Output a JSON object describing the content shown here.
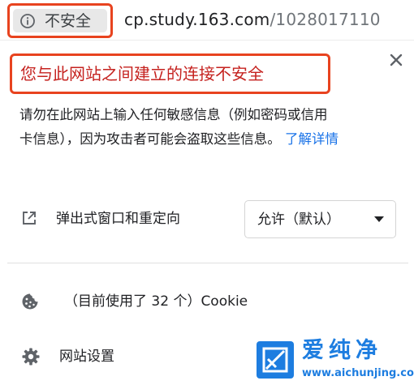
{
  "address_bar": {
    "security_label": "不安全",
    "url_host": "cp.study.163.com",
    "url_path": "/1028017110"
  },
  "popup": {
    "headline": "您与此网站之间建立的连接不安全",
    "description_line1": "请勿在此网站上输入任何敏感信息（例如密码或信用",
    "description_line2": "卡信息），因为攻击者可能会盗取这些信息。",
    "learn_more_link": "了解详情",
    "popup_permission": {
      "label": "弹出式窗口和重定向",
      "selected_option": "允许（默认）"
    },
    "cookies": {
      "label": "（目前使用了 32 个）Cookie"
    },
    "site_settings": {
      "label": "网站设置"
    }
  },
  "watermark": {
    "title": "爱纯净",
    "url": "www.aichunjing.com"
  },
  "colors": {
    "highlight_border": "#e8431f",
    "headline_red": "#c5221f",
    "link_blue": "#1a73e8",
    "watermark_blue": "#1d7de0"
  },
  "icons": {
    "info": "info-icon",
    "close": "close-icon",
    "popup": "external-link-icon",
    "dropdown": "caret-down-icon",
    "cookie": "cookie-icon",
    "settings": "gear-icon"
  }
}
